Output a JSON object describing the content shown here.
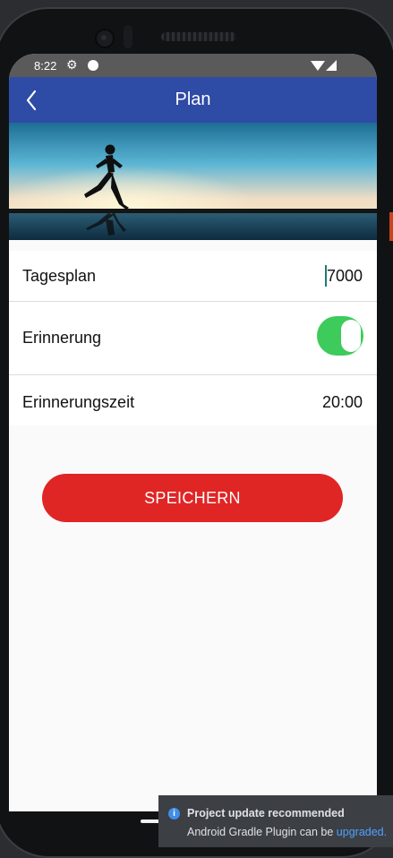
{
  "status_bar": {
    "time": "8:22",
    "settings_icon": "gear-icon",
    "notification_icon": "dot-icon",
    "wifi_icon": "wifi-icon",
    "signal_icon": "signal-icon"
  },
  "app_bar": {
    "title": "Plan",
    "back_icon": "chevron-left-icon",
    "color": "#2e4ba5"
  },
  "hero_image": {
    "description_icon": "runner-silhouette-image"
  },
  "settings": {
    "daily_plan": {
      "label": "Tagesplan",
      "value": "7000"
    },
    "reminder": {
      "label": "Erinnerung",
      "enabled": true,
      "toggle_color": "#3dcb5c"
    },
    "reminder_time": {
      "label": "Erinnerungszeit",
      "value": "20:00"
    }
  },
  "save_button": {
    "label": "SPEICHERN",
    "color": "#e02525"
  },
  "notification": {
    "title": "Project update recommended",
    "body_prefix": "Android Gradle Plugin can be",
    "body_link": "upgraded."
  }
}
